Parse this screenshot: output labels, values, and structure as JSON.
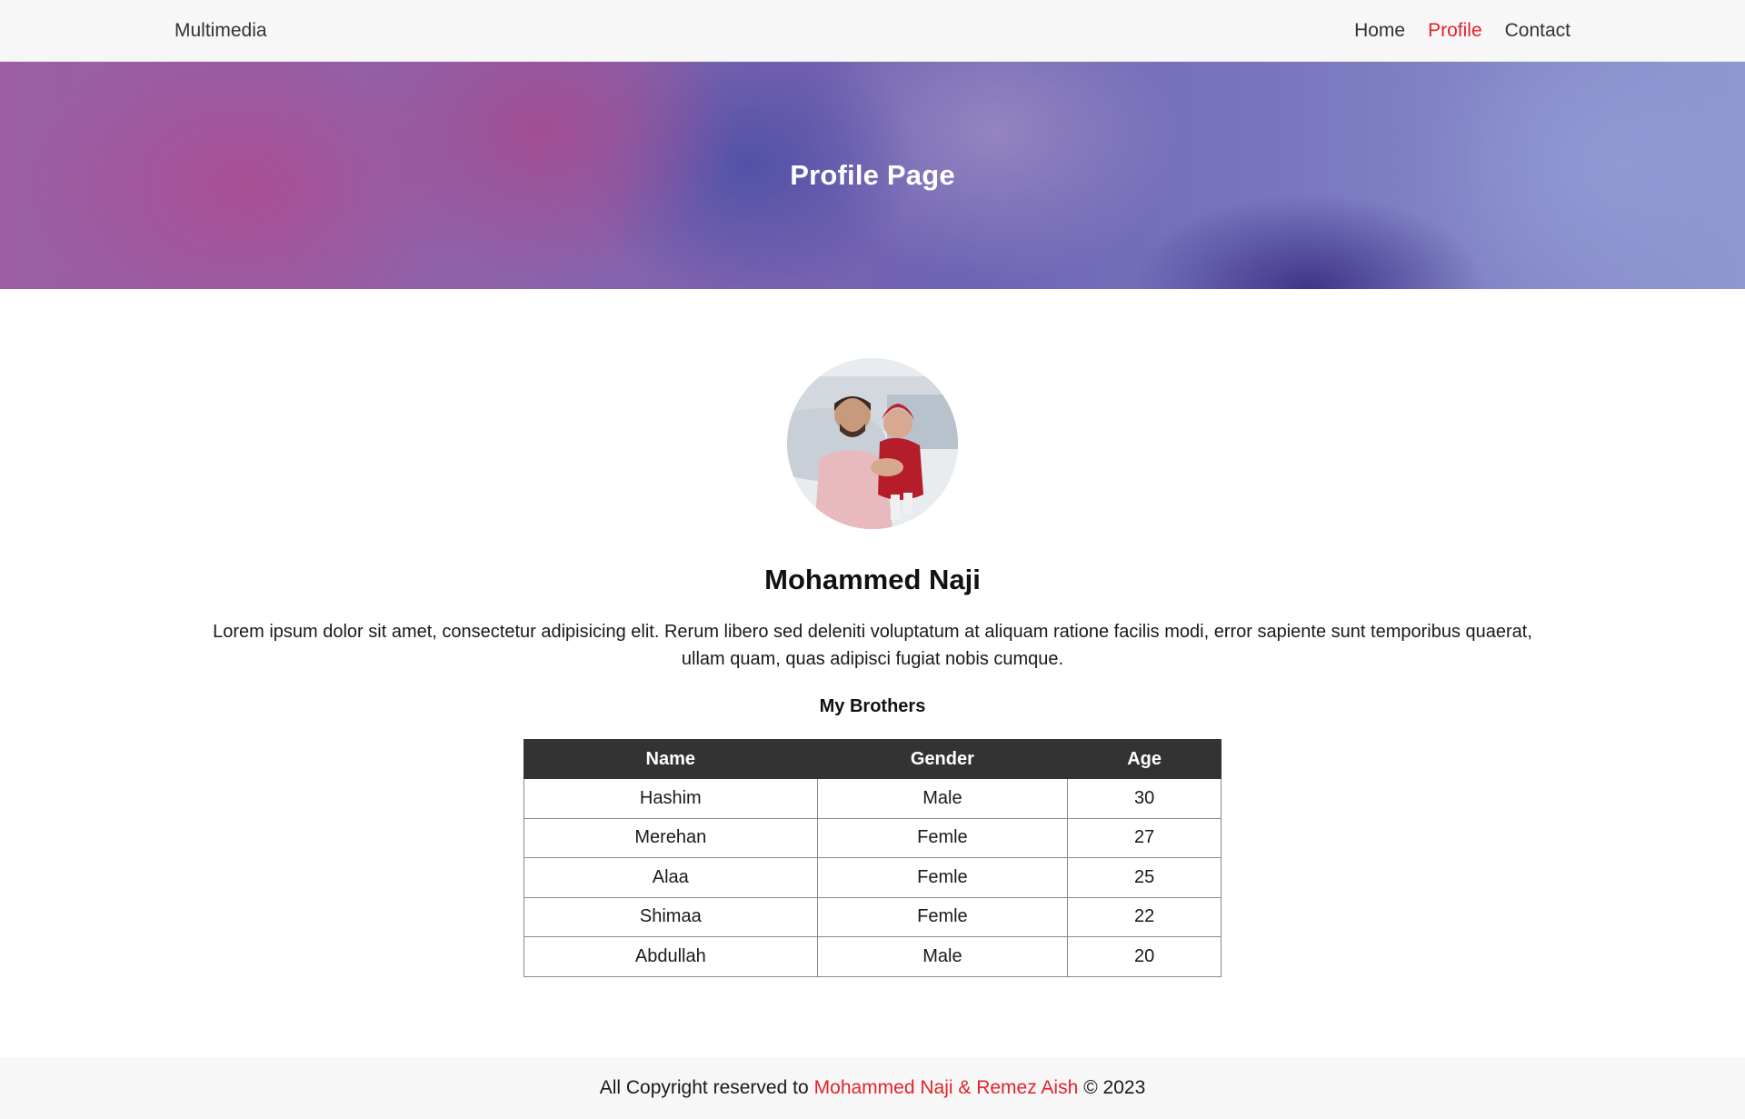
{
  "navbar": {
    "brand": "Multimedia",
    "links": [
      {
        "label": "Home",
        "active": false
      },
      {
        "label": "Profile",
        "active": true
      },
      {
        "label": "Contact",
        "active": false
      }
    ]
  },
  "hero": {
    "title": "Profile Page"
  },
  "profile": {
    "name": "Mohammed Naji",
    "bio": "Lorem ipsum dolor sit amet, consectetur adipisicing elit. Rerum libero sed deleniti voluptatum at aliquam ratione facilis modi, error sapiente sunt temporibus quaerat, ullam quam, quas adipisci fugiat nobis cumque.",
    "brothers_title": "My Brothers",
    "table": {
      "headers": [
        "Name",
        "Gender",
        "Age"
      ],
      "rows": [
        [
          "Hashim",
          "Male",
          "30"
        ],
        [
          "Merehan",
          "Femle",
          "27"
        ],
        [
          "Alaa",
          "Femle",
          "25"
        ],
        [
          "Shimaa",
          "Femle",
          "22"
        ],
        [
          "Abdullah",
          "Male",
          "20"
        ]
      ]
    }
  },
  "footer": {
    "prefix": "All Copyright reserved to",
    "authors": "Mohammed Naji & Remez Aish",
    "suffix": "© 2023"
  },
  "colors": {
    "accent": "#e3232b",
    "table_header_bg": "#333333",
    "navbar_bg": "#f7f7f7"
  }
}
